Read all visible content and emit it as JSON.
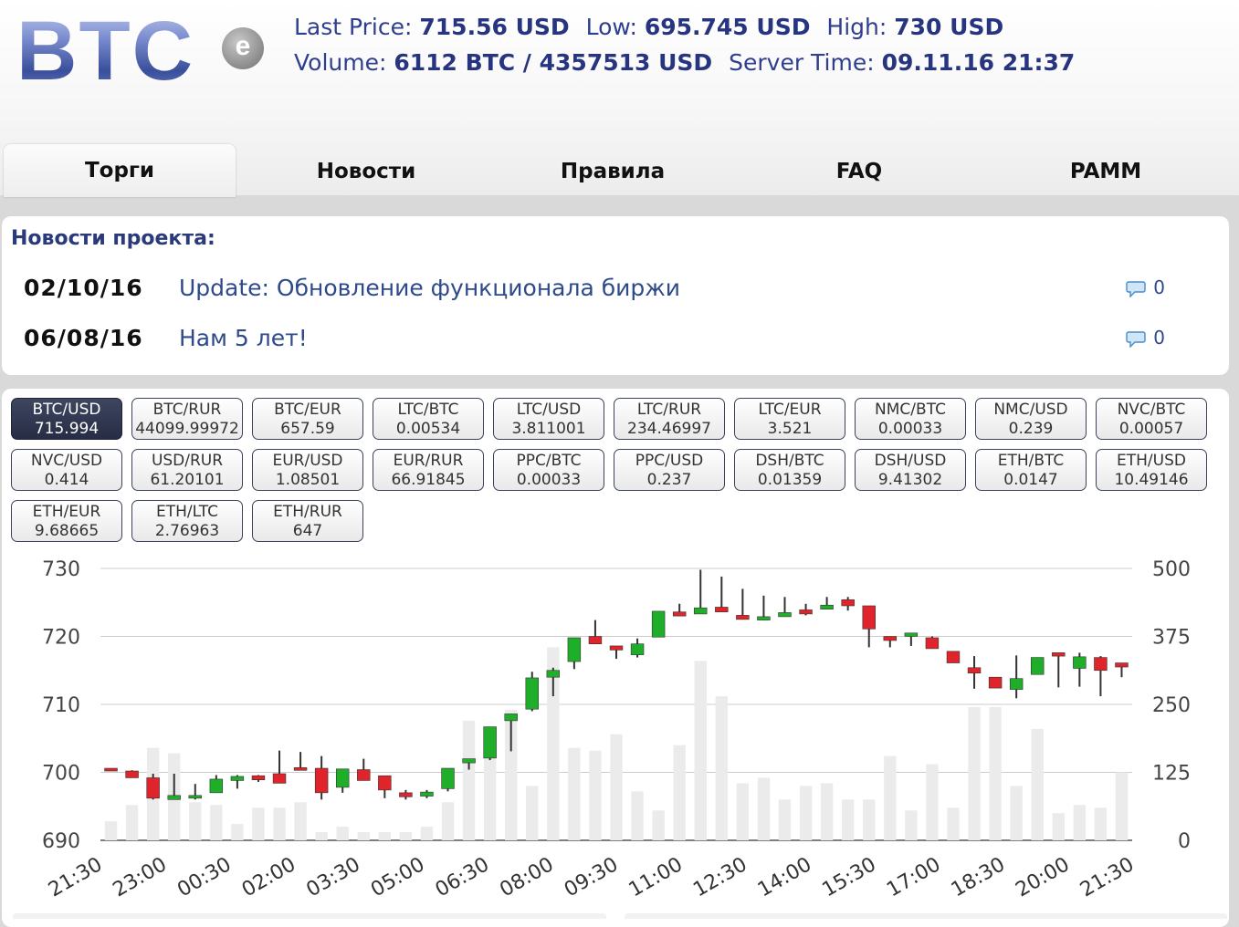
{
  "logo": {
    "text": "BTC",
    "badge": "e"
  },
  "stats": {
    "last_price_label": "Last Price:",
    "last_price": "715.56 USD",
    "low_label": "Low:",
    "low": "695.745 USD",
    "high_label": "High:",
    "high": "730 USD",
    "volume_label": "Volume:",
    "volume": "6112 BTC / 4357513 USD",
    "server_time_label": "Server Time:",
    "server_time": "09.11.16 21:37"
  },
  "tabs": [
    {
      "label": "Торги",
      "active": true
    },
    {
      "label": "Новости"
    },
    {
      "label": "Правила"
    },
    {
      "label": "FAQ"
    },
    {
      "label": "PAMM"
    }
  ],
  "news": {
    "title": "Новости проекта:",
    "items": [
      {
        "date": "02/10/16",
        "text": "Update: Обновление функционала биржи",
        "comments": "0"
      },
      {
        "date": "06/08/16",
        "text": "Нам 5 лет!",
        "comments": "0"
      }
    ]
  },
  "pairs": [
    {
      "name": "BTC/USD",
      "price": "715.994",
      "active": true
    },
    {
      "name": "BTC/RUR",
      "price": "44099.99972"
    },
    {
      "name": "BTC/EUR",
      "price": "657.59"
    },
    {
      "name": "LTC/BTC",
      "price": "0.00534"
    },
    {
      "name": "LTC/USD",
      "price": "3.811001"
    },
    {
      "name": "LTC/RUR",
      "price": "234.46997"
    },
    {
      "name": "LTC/EUR",
      "price": "3.521"
    },
    {
      "name": "NMC/BTC",
      "price": "0.00033"
    },
    {
      "name": "NMC/USD",
      "price": "0.239"
    },
    {
      "name": "NVC/BTC",
      "price": "0.00057"
    },
    {
      "name": "NVC/USD",
      "price": "0.414"
    },
    {
      "name": "USD/RUR",
      "price": "61.20101"
    },
    {
      "name": "EUR/USD",
      "price": "1.08501"
    },
    {
      "name": "EUR/RUR",
      "price": "66.91845"
    },
    {
      "name": "PPC/BTC",
      "price": "0.00033"
    },
    {
      "name": "PPC/USD",
      "price": "0.237"
    },
    {
      "name": "DSH/BTC",
      "price": "0.01359"
    },
    {
      "name": "DSH/USD",
      "price": "9.41302"
    },
    {
      "name": "ETH/BTC",
      "price": "0.0147"
    },
    {
      "name": "ETH/USD",
      "price": "10.49146"
    },
    {
      "name": "ETH/EUR",
      "price": "9.68665"
    },
    {
      "name": "ETH/LTC",
      "price": "2.76963"
    },
    {
      "name": "ETH/RUR",
      "price": "647"
    }
  ],
  "colors": {
    "up": "#1fae2a",
    "down": "#e0242b",
    "volume": "#ebebeb",
    "grid": "#cccccc"
  },
  "chart_data": {
    "type": "candlestick",
    "price_ylim": [
      690,
      730
    ],
    "price_ticks": [
      690,
      700,
      710,
      720,
      730
    ],
    "volume_ylim": [
      0,
      500
    ],
    "volume_ticks": [
      0,
      125,
      250,
      375,
      500
    ],
    "x_tick_labels": [
      "21:30",
      "23:00",
      "00:30",
      "02:00",
      "03:30",
      "05:00",
      "06:30",
      "08:00",
      "09:30",
      "11:00",
      "12:30",
      "14:00",
      "15:30",
      "17:00",
      "18:30",
      "20:00",
      "21:30"
    ],
    "candles": [
      [
        700.6,
        700.2,
        700.6,
        700.2
      ],
      [
        700.2,
        699.2,
        700.3,
        699.2
      ],
      [
        699.2,
        696.2,
        699.8,
        696.0
      ],
      [
        696.0,
        696.6,
        699.8,
        696.0
      ],
      [
        696.2,
        696.6,
        698.3,
        696.0
      ],
      [
        697.0,
        699.0,
        699.6,
        697.0
      ],
      [
        698.8,
        699.4,
        699.6,
        697.6
      ],
      [
        699.5,
        698.9,
        699.6,
        698.6
      ],
      [
        699.8,
        698.4,
        703.2,
        698.4
      ],
      [
        700.7,
        700.3,
        703.0,
        700.3
      ],
      [
        700.6,
        697.0,
        702.4,
        696.0
      ],
      [
        697.8,
        700.5,
        700.5,
        697.0
      ],
      [
        700.4,
        698.8,
        702.0,
        698.8
      ],
      [
        699.5,
        697.4,
        699.5,
        696.2
      ],
      [
        697.0,
        696.4,
        697.4,
        696.0
      ],
      [
        696.5,
        697.1,
        697.4,
        696.2
      ],
      [
        697.6,
        700.6,
        700.6,
        697.2
      ],
      [
        701.4,
        702.0,
        702.0,
        700.4
      ],
      [
        702.1,
        706.7,
        706.7,
        701.8
      ],
      [
        707.6,
        708.6,
        708.6,
        703.1
      ],
      [
        709.3,
        713.9,
        714.8,
        709.0
      ],
      [
        714.0,
        715.0,
        715.4,
        711.2
      ],
      [
        716.3,
        719.8,
        719.8,
        715.2
      ],
      [
        720.0,
        718.9,
        722.4,
        718.9
      ],
      [
        718.6,
        718.0,
        718.6,
        716.7
      ],
      [
        717.3,
        718.9,
        719.7,
        716.9
      ],
      [
        719.9,
        723.7,
        723.7,
        719.9
      ],
      [
        723.6,
        723.0,
        724.8,
        723.0
      ],
      [
        723.3,
        724.2,
        729.8,
        723.3
      ],
      [
        724.3,
        723.6,
        728.8,
        723.6
      ],
      [
        723.1,
        722.5,
        727.0,
        722.5
      ],
      [
        722.4,
        722.9,
        726.0,
        722.4
      ],
      [
        722.9,
        723.5,
        725.8,
        723.0
      ],
      [
        723.9,
        723.3,
        724.8,
        723.1
      ],
      [
        724.0,
        724.6,
        725.8,
        724.0
      ],
      [
        725.4,
        724.5,
        725.8,
        723.8
      ],
      [
        724.5,
        721.1,
        724.5,
        718.4
      ],
      [
        720.0,
        719.4,
        720.0,
        718.4
      ],
      [
        720.0,
        720.5,
        720.5,
        718.6
      ],
      [
        719.8,
        718.2,
        720.0,
        718.2
      ],
      [
        717.8,
        716.1,
        717.8,
        716.1
      ],
      [
        715.4,
        714.6,
        717.1,
        712.3
      ],
      [
        714.0,
        712.4,
        714.0,
        712.4
      ],
      [
        712.2,
        713.8,
        717.2,
        710.9
      ],
      [
        714.4,
        716.9,
        716.9,
        714.4
      ],
      [
        717.6,
        717.1,
        717.6,
        712.5
      ],
      [
        715.3,
        717.0,
        717.6,
        712.6
      ],
      [
        716.9,
        715.0,
        717.1,
        711.2
      ],
      [
        716.1,
        715.5,
        716.1,
        714.0
      ]
    ],
    "volumes": [
      35,
      65,
      170,
      160,
      70,
      65,
      30,
      60,
      60,
      70,
      15,
      25,
      15,
      15,
      15,
      25,
      70,
      220,
      190,
      240,
      100,
      355,
      170,
      165,
      195,
      90,
      55,
      175,
      330,
      265,
      105,
      115,
      75,
      100,
      105,
      75,
      75,
      155,
      55,
      140,
      60,
      245,
      245,
      100,
      205,
      50,
      65,
      60,
      125
    ]
  }
}
